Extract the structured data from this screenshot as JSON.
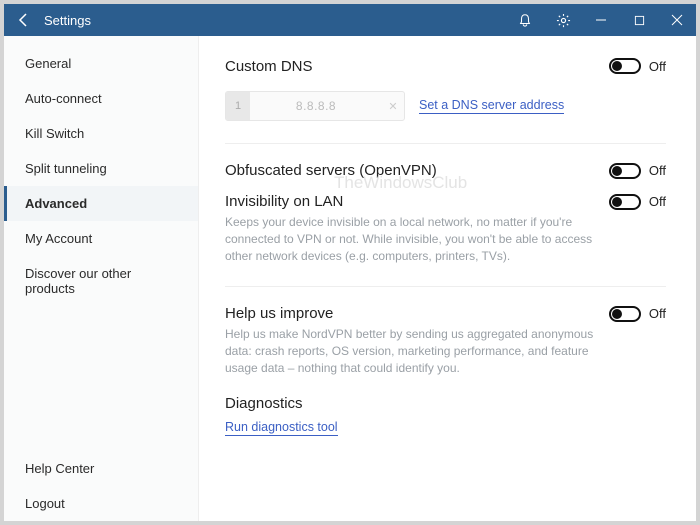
{
  "header": {
    "title": "Settings"
  },
  "sidebar": {
    "items": [
      {
        "label": "General"
      },
      {
        "label": "Auto-connect"
      },
      {
        "label": "Kill Switch"
      },
      {
        "label": "Split tunneling"
      },
      {
        "label": "Advanced"
      },
      {
        "label": "My Account"
      },
      {
        "label": "Discover our other products"
      }
    ],
    "footer": [
      {
        "label": "Help Center"
      },
      {
        "label": "Logout"
      }
    ]
  },
  "content": {
    "custom_dns": {
      "title": "Custom DNS",
      "toggle_state": "Off",
      "input_number": "1",
      "input_placeholder": "8.8.8.8",
      "link_text": "Set a DNS server address"
    },
    "obfuscated": {
      "title": "Obfuscated servers (OpenVPN)",
      "toggle_state": "Off"
    },
    "invisibility": {
      "title": "Invisibility on LAN",
      "toggle_state": "Off",
      "desc": "Keeps your device invisible on a local network, no matter if you're connected to VPN or not. While invisible, you won't be able to access other network devices (e.g. computers, printers, TVs)."
    },
    "help_improve": {
      "title": "Help us improve",
      "toggle_state": "Off",
      "desc": "Help us make NordVPN better by sending us aggregated anonymous data: crash reports, OS version, marketing performance, and feature usage data – nothing that could identify you."
    },
    "diagnostics": {
      "title": "Diagnostics",
      "link": "Run diagnostics tool"
    }
  },
  "watermark": "TheWindowsClub",
  "colors": {
    "accent": "#2b5d8e",
    "link": "#3b5fc4",
    "arrow": "#e63232"
  }
}
